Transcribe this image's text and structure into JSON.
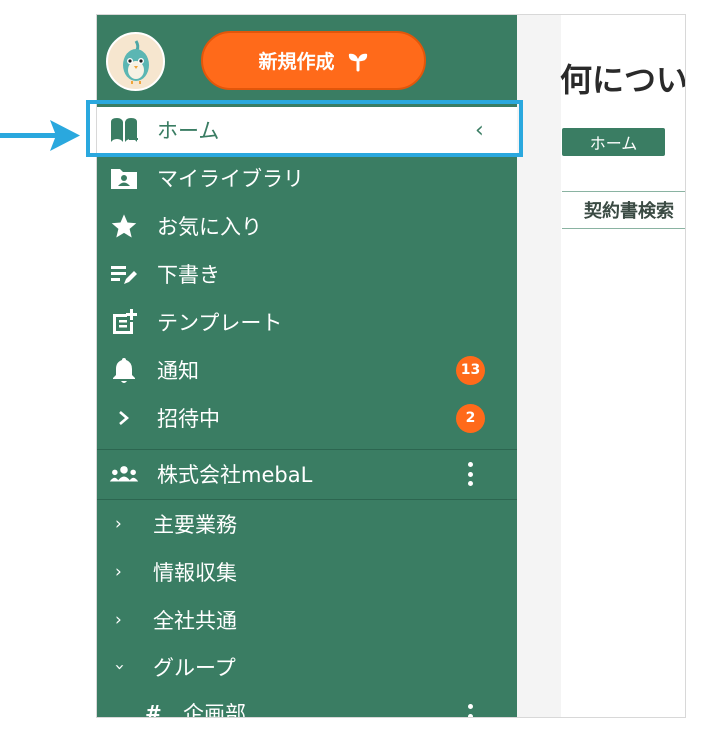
{
  "sidebar": {
    "avatar_icon": "bird-mascot-icon",
    "new_button_label": "新規作成",
    "new_button_icon": "sprout-icon",
    "nav_items": [
      {
        "label": "ホーム",
        "icon": "home-book-icon",
        "active": true
      },
      {
        "label": "マイライブラリ",
        "icon": "folder-person-icon"
      },
      {
        "label": "お気に入り",
        "icon": "star-icon"
      },
      {
        "label": "下書き",
        "icon": "draft-pen-icon"
      },
      {
        "label": "テンプレート",
        "icon": "template-add-icon"
      },
      {
        "label": "通知",
        "icon": "bell-icon",
        "badge": "13"
      },
      {
        "label": "招待中",
        "icon": "chevron-right-icon",
        "badge": "2"
      }
    ],
    "organization": {
      "label": "株式会社mebaL",
      "icon": "group-people-icon"
    },
    "sub_items": [
      {
        "label": "主要業務",
        "state": "collapsed"
      },
      {
        "label": "情報収集",
        "state": "collapsed"
      },
      {
        "label": "全社共通",
        "state": "collapsed"
      },
      {
        "label": "グループ",
        "state": "expanded"
      }
    ],
    "group_item": {
      "prefix": "#",
      "label": "企画部"
    }
  },
  "main": {
    "title": "何につい",
    "breadcrumb": "ホーム",
    "search_tab_label": "契約書検索"
  },
  "colors": {
    "sidebar_bg": "#3a7d63",
    "accent": "#ff6a1a",
    "highlight": "#2aa8de"
  }
}
